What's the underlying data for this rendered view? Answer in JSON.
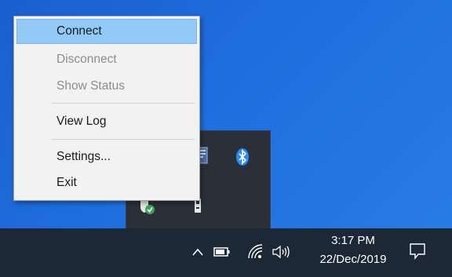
{
  "context_menu": {
    "items": [
      {
        "label": "Connect",
        "state": "highlighted"
      },
      {
        "label": "Disconnect",
        "state": "disabled"
      },
      {
        "label": "Show Status",
        "state": "disabled"
      },
      {
        "label": "View Log",
        "state": "enabled"
      },
      {
        "label": "Settings...",
        "state": "enabled"
      },
      {
        "label": "Exit",
        "state": "enabled"
      }
    ]
  },
  "tray_overflow": {
    "icons": [
      "document-icon",
      "bluetooth-icon",
      "shield-icon",
      "usb-drive-icon"
    ]
  },
  "taskbar": {
    "icons": [
      "chevron-up-icon",
      "battery-icon",
      "wifi-icon",
      "volume-icon",
      "notification-icon"
    ],
    "clock": {
      "time": "3:17 PM",
      "date": "22/Dec/2019"
    }
  },
  "colors": {
    "desktop": "#1f6fe0",
    "taskbar": "#1c2836",
    "menu_bg": "#f2f2f2",
    "menu_highlight": "#91c9f7",
    "disabled_text": "#8d8d8d",
    "bluetooth": "#2a8af6",
    "shield_green": "#3aa655"
  }
}
